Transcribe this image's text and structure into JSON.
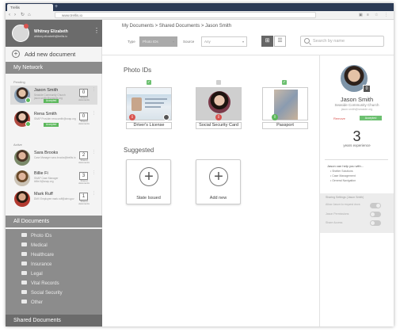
{
  "browser": {
    "tab_title": "Trellis",
    "url": "www.trellis.io",
    "back": "‹",
    "forward": "›",
    "reload": "↻",
    "home": "⌂",
    "newtab": "+",
    "ext_icons": [
      "▣",
      "≡",
      "☆",
      "⋮"
    ]
  },
  "user": {
    "name": "Whitney Elizabeth",
    "email": "whitney.elizabeth@trellis.io",
    "menu": "⋮"
  },
  "sidebar": {
    "add_document": "Add new document",
    "add_icon": "+",
    "my_network": "My Network",
    "pending_label": "Pending",
    "active_label": "Active",
    "pending": [
      {
        "name": "Jason Smith",
        "sub": "Seaside Community Church jason.smith@seaside.org",
        "status": "Accepted",
        "docs": "0",
        "docs_label": "Shared documents",
        "menu": "⋮"
      },
      {
        "name": "Rena Smith",
        "sub": "SNAP Provider rena.smith@snap.org",
        "status": "Accepted",
        "docs": "0",
        "docs_label": "Shared documents",
        "menu": "⋮"
      }
    ],
    "active": [
      {
        "name": "Sara Brooks",
        "sub": "Case Manager sara.brooks@trellis.io",
        "docs": "2",
        "docs_label": "Shared documents",
        "menu": "⋮"
      },
      {
        "name": "Billie Fi",
        "sub": "SNAP Case Manager billie.fi@snap.org",
        "docs": "3",
        "docs_label": "Shared documents",
        "menu": "⋮"
      },
      {
        "name": "Mark Ruff",
        "sub": "DMV Employee mark.ruff@dmv.gov",
        "docs": "1",
        "docs_label": "Shared documents",
        "menu": "⋮"
      }
    ],
    "all_documents": "All Documents",
    "folders": [
      "Photo IDs",
      "Medical",
      "Healthcare",
      "Insurance",
      "Legal",
      "Vital Records",
      "Social Security",
      "Other"
    ],
    "shared_documents": "Shared Documents"
  },
  "main": {
    "breadcrumb": "My Documents  >  Shared Documents  >  Jason Smith",
    "filter_type_label": "Type",
    "filter_type_value": "Photo IDs",
    "filter_source_label": "Source",
    "filter_source_value": "Any",
    "caret": "▾",
    "grid_icon": "⊞",
    "list_icon": "☰",
    "search_placeholder": "Search by name",
    "photo_ids_title": "Photo IDs",
    "check": "✓",
    "cards": [
      {
        "label": "Driver's License",
        "checked": true
      },
      {
        "label": "Social Security Card",
        "checked": false
      },
      {
        "label": "Passport",
        "checked": true
      }
    ],
    "card_doc_mark": "⇩",
    "card_share_mark": "⇧",
    "suggested_title": "Suggested",
    "plus": "+",
    "suggested": [
      "State Issued",
      "Add new"
    ]
  },
  "right_panel": {
    "name": "Jason Smith",
    "org": "Seaside Community Church",
    "email": "jason.smith@seaside.org",
    "doc_count": "0",
    "link": "Remove",
    "status": "Accepted",
    "years_number": "3",
    "years_label": "years experience",
    "help_title": "Jason can help you with...",
    "help_items": [
      "• Shelter Solutions",
      "• Case Management",
      "• General Navigation"
    ],
    "settings_title": "Sharing Settings (Jason Smith)",
    "options": [
      "Allow Jason to request docs",
      "Jason Permissions",
      "Share Access"
    ],
    "toggles": [
      true,
      false,
      false
    ]
  },
  "colors": {
    "sidebar_header": "#6b6b6b",
    "section": "#8c8c8c",
    "accent_green": "#6cc070",
    "accent_red": "#d9534f"
  }
}
